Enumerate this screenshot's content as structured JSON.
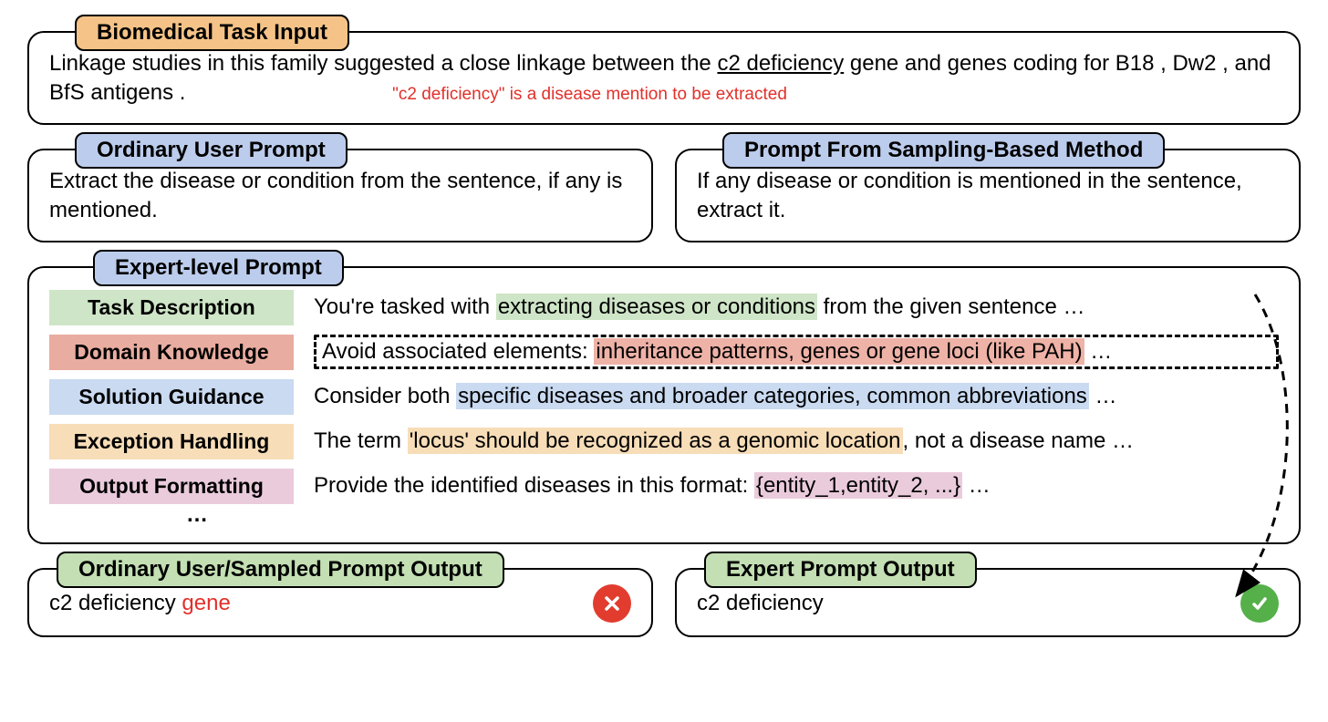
{
  "input": {
    "title": "Biomedical Task Input",
    "sentence_pre": "Linkage studies in this family suggested a close linkage between the ",
    "sentence_underlined": "c2 deficiency",
    "sentence_post": " gene and genes coding for B18 , Dw2 , and BfS antigens .",
    "note": "\"c2 deficiency\" is a disease mention to be extracted"
  },
  "ordinary": {
    "title": "Ordinary User Prompt",
    "body": "Extract the disease or condition from the sentence, if any is mentioned."
  },
  "sampling": {
    "title": "Prompt From Sampling-Based Method",
    "body": "If any disease or condition is mentioned in the sentence, extract it."
  },
  "expert": {
    "title": "Expert-level Prompt",
    "rows": {
      "task_desc": {
        "label": "Task Description",
        "pre": "You're tasked with ",
        "hl": "extracting diseases or conditions",
        "post": " from the given sentence …"
      },
      "domain": {
        "label": "Domain Knowledge",
        "pre": "Avoid associated elements: ",
        "hl": "inheritance patterns, genes or gene loci (like PAH)",
        "post": " …"
      },
      "solution": {
        "label": "Solution Guidance",
        "pre": "Consider both ",
        "hl": "specific diseases and broader categories, common abbreviations",
        "post": " …"
      },
      "exception": {
        "label": "Exception Handling",
        "pre": "The term ",
        "hl": "'locus' should be recognized as a genomic location",
        "post": ", not a disease name …"
      },
      "output": {
        "label": "Output Formatting",
        "pre": "Provide the identified diseases in this format: ",
        "hl": "{entity_1,entity_2, ...}",
        "post": " …"
      }
    },
    "ellipsis": "…"
  },
  "outputs": {
    "ordinary": {
      "title": "Ordinary User/Sampled Prompt Output",
      "text": "c2 deficiency ",
      "wrong": "gene"
    },
    "expert": {
      "title": "Expert Prompt Output",
      "text": "c2 deficiency"
    }
  }
}
